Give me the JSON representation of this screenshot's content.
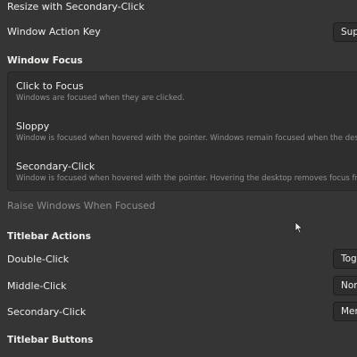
{
  "settings": {
    "resize_label": "Resize with Secondary-Click",
    "window_action_key": {
      "label": "Window Action Key",
      "value": "Sup"
    },
    "window_focus": {
      "heading": "Window Focus",
      "options": [
        {
          "title": "Click to Focus",
          "description": "Windows are focused when they are clicked."
        },
        {
          "title": "Sloppy",
          "description": "Window is focused when hovered with the pointer. Windows remain focused when the deskto"
        },
        {
          "title": "Secondary-Click",
          "description": "Window is focused when hovered with the pointer. Hovering the desktop removes focus from"
        }
      ]
    },
    "raise_windows_label": "Raise Windows When Focused",
    "titlebar_actions": {
      "heading": "Titlebar Actions",
      "double_click": {
        "label": "Double-Click",
        "value": "Tog"
      },
      "middle_click": {
        "label": "Middle-Click",
        "value": "Nor"
      },
      "secondary_click": {
        "label": "Secondary-Click",
        "value": "Men"
      }
    },
    "titlebar_buttons": {
      "heading": "Titlebar Buttons"
    }
  },
  "icons": {
    "cursor": "mouse-pointer-icon"
  }
}
